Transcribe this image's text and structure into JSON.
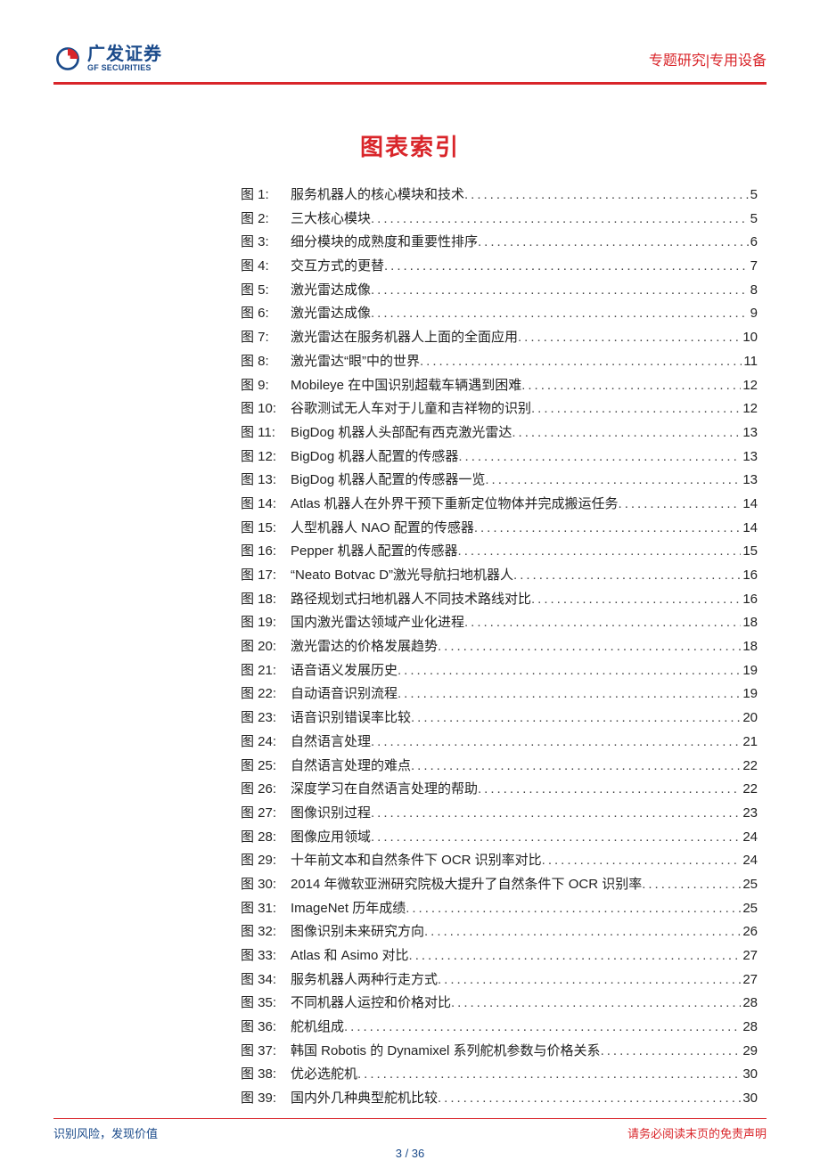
{
  "header": {
    "logo_cn": "广发证券",
    "logo_en": "GF SECURITIES",
    "right_text": "专题研究|专用设备"
  },
  "title": "图表索引",
  "toc": [
    {
      "label": "图 1:",
      "title": "服务机器人的核心模块和技术",
      "page": "5"
    },
    {
      "label": "图 2:",
      "title": "三大核心模块",
      "page": "5"
    },
    {
      "label": "图 3:",
      "title": "细分模块的成熟度和重要性排序",
      "page": "6"
    },
    {
      "label": "图 4:",
      "title": "交互方式的更替",
      "page": "7"
    },
    {
      "label": "图 5:",
      "title": "激光雷达成像",
      "page": "8"
    },
    {
      "label": "图 6:",
      "title": "激光雷达成像",
      "page": "9"
    },
    {
      "label": "图 7:",
      "title": "激光雷达在服务机器人上面的全面应用",
      "page": "10"
    },
    {
      "label": "图 8:",
      "title": "激光雷达“眼”中的世界",
      "page": "11"
    },
    {
      "label": "图 9:",
      "title": "Mobileye 在中国识别超载车辆遇到困难",
      "page": "12"
    },
    {
      "label": "图 10:",
      "title": "谷歌测试无人车对于儿童和吉祥物的识别",
      "page": "12"
    },
    {
      "label": "图 11:",
      "title": "BigDog 机器人头部配有西克激光雷达",
      "page": "13"
    },
    {
      "label": "图 12:",
      "title": "BigDog 机器人配置的传感器",
      "page": "13"
    },
    {
      "label": "图 13:",
      "title": "BigDog 机器人配置的传感器一览",
      "page": "13"
    },
    {
      "label": "图 14:",
      "title": "Atlas 机器人在外界干预下重新定位物体并完成搬运任务",
      "page": "14"
    },
    {
      "label": "图 15:",
      "title": "人型机器人 NAO 配置的传感器",
      "page": "14"
    },
    {
      "label": "图 16:",
      "title": "Pepper 机器人配置的传感器",
      "page": "15"
    },
    {
      "label": "图 17:",
      "title": "“Neato Botvac D”激光导航扫地机器人",
      "page": "16"
    },
    {
      "label": "图 18:",
      "title": "路径规划式扫地机器人不同技术路线对比",
      "page": "16"
    },
    {
      "label": "图 19:",
      "title": "国内激光雷达领域产业化进程",
      "page": "18"
    },
    {
      "label": "图 20:",
      "title": "激光雷达的价格发展趋势",
      "page": "18"
    },
    {
      "label": "图 21:",
      "title": "语音语义发展历史",
      "page": "19"
    },
    {
      "label": "图 22:",
      "title": "自动语音识别流程",
      "page": "19"
    },
    {
      "label": "图 23:",
      "title": "语音识别错误率比较",
      "page": "20"
    },
    {
      "label": "图 24:",
      "title": "自然语言处理",
      "page": "21"
    },
    {
      "label": "图 25:",
      "title": "自然语言处理的难点",
      "page": "22"
    },
    {
      "label": "图 26:",
      "title": "深度学习在自然语言处理的帮助",
      "page": "22"
    },
    {
      "label": "图 27:",
      "title": "图像识别过程",
      "page": "23"
    },
    {
      "label": "图 28:",
      "title": "图像应用领域",
      "page": "24"
    },
    {
      "label": "图 29:",
      "title": "十年前文本和自然条件下 OCR 识别率对比",
      "page": "24"
    },
    {
      "label": "图 30:",
      "title": "2014 年微软亚洲研究院极大提升了自然条件下 OCR 识别率",
      "page": "25"
    },
    {
      "label": "图 31:",
      "title": "ImageNet 历年成绩",
      "page": "25"
    },
    {
      "label": "图 32:",
      "title": "图像识别未来研究方向",
      "page": "26"
    },
    {
      "label": "图 33:",
      "title": "Atlas 和 Asimo 对比",
      "page": "27"
    },
    {
      "label": "图 34:",
      "title": "服务机器人两种行走方式",
      "page": "27"
    },
    {
      "label": "图 35:",
      "title": "不同机器人运控和价格对比",
      "page": "28"
    },
    {
      "label": "图 36:",
      "title": "舵机组成",
      "page": "28"
    },
    {
      "label": "图 37:",
      "title": "韩国 Robotis 的 Dynamixel 系列舵机参数与价格关系",
      "page": "29"
    },
    {
      "label": "图 38:",
      "title": "优必选舵机",
      "page": "30"
    },
    {
      "label": "图 39:",
      "title": "国内外几种典型舵机比较",
      "page": "30"
    }
  ],
  "footer": {
    "left": "识别风险，发现价值",
    "right": "请务必阅读末页的免责声明",
    "page": "3 / 36"
  }
}
